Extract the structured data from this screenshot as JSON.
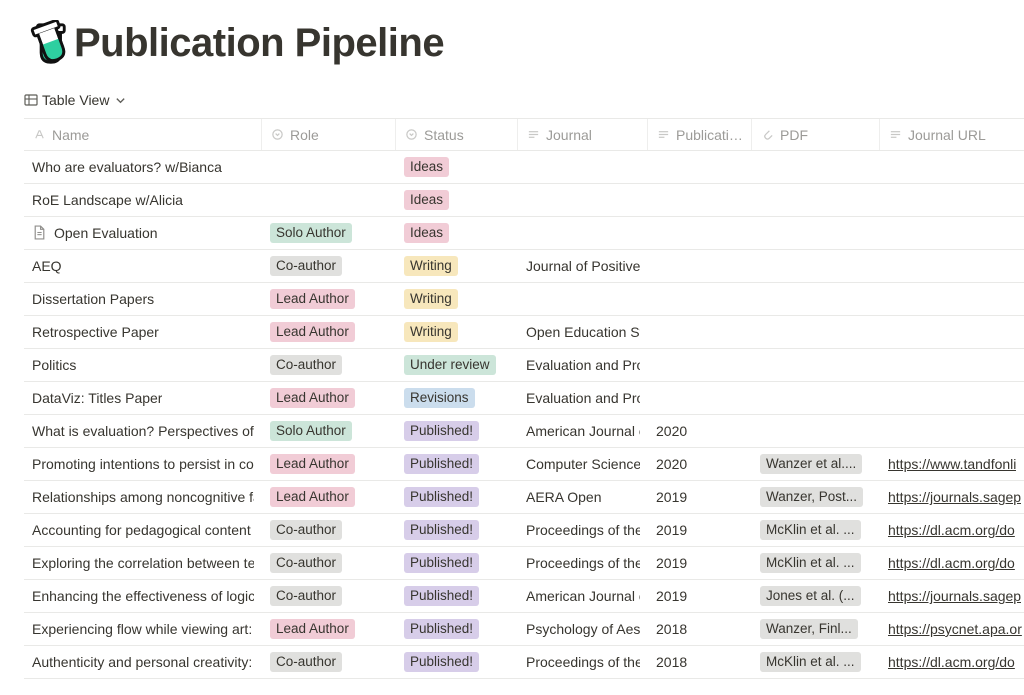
{
  "page": {
    "title": "Publication Pipeline"
  },
  "view": {
    "label": "Table View"
  },
  "columns": {
    "name": "Name",
    "role": "Role",
    "status": "Status",
    "journal": "Journal",
    "publication": "Publicati…",
    "pdf": "PDF",
    "journal_url": "Journal URL"
  },
  "tagColors": {
    "Solo Author": "green",
    "Co-author": "gray",
    "Lead Author": "pink",
    "Ideas": "pink",
    "Writing": "yellow",
    "Under review": "green",
    "Revisions": "blue",
    "Published!": "purple"
  },
  "rows": [
    {
      "name": "Who are evaluators? w/Bianca",
      "role": "",
      "status": "Ideas",
      "journal": "",
      "year": "",
      "pdf": "",
      "url": "",
      "hasIcon": false
    },
    {
      "name": "RoE Landscape w/Alicia",
      "role": "",
      "status": "Ideas",
      "journal": "",
      "year": "",
      "pdf": "",
      "url": "",
      "hasIcon": false
    },
    {
      "name": "Open Evaluation",
      "role": "Solo Author",
      "status": "Ideas",
      "journal": "",
      "year": "",
      "pdf": "",
      "url": "",
      "hasIcon": true
    },
    {
      "name": "AEQ",
      "role": "Co-author",
      "status": "Writing",
      "journal": "Journal of Positive ",
      "year": "",
      "pdf": "",
      "url": "",
      "hasIcon": false
    },
    {
      "name": "Dissertation Papers",
      "role": "Lead Author",
      "status": "Writing",
      "journal": "",
      "year": "",
      "pdf": "",
      "url": "",
      "hasIcon": false
    },
    {
      "name": "Retrospective Paper",
      "role": "Lead Author",
      "status": "Writing",
      "journal": "Open Education Stu",
      "year": "",
      "pdf": "",
      "url": "",
      "hasIcon": false
    },
    {
      "name": "Politics",
      "role": "Co-author",
      "status": "Under review",
      "journal": "Evaluation and Pro",
      "year": "",
      "pdf": "",
      "url": "",
      "hasIcon": false
    },
    {
      "name": "DataViz: Titles Paper",
      "role": "Lead Author",
      "status": "Revisions",
      "journal": "Evaluation and Pro",
      "year": "",
      "pdf": "",
      "url": "",
      "hasIcon": false
    },
    {
      "name": "What is evaluation? Perspectives of h",
      "role": "Solo Author",
      "status": "Published!",
      "journal": "American Journal o",
      "year": "2020",
      "pdf": "",
      "url": "",
      "hasIcon": false
    },
    {
      "name": "Promoting intentions to persist in co",
      "role": "Lead Author",
      "status": "Published!",
      "journal": "Computer Science",
      "year": "2020",
      "pdf": "Wanzer et al....",
      "url": "https://www.tandfonli",
      "hasIcon": false
    },
    {
      "name": "Relationships among noncognitive fa",
      "role": "Lead Author",
      "status": "Published!",
      "journal": "AERA Open",
      "year": "2019",
      "pdf": "Wanzer, Post...",
      "url": "https://journals.sagep",
      "hasIcon": false
    },
    {
      "name": "Accounting for pedagogical content",
      "role": "Co-author",
      "status": "Published!",
      "journal": "Proceedings of the",
      "year": "2019",
      "pdf": "McKlin et al. ...",
      "url": "https://dl.acm.org/do",
      "hasIcon": false
    },
    {
      "name": "Exploring the correlation between te",
      "role": "Co-author",
      "status": "Published!",
      "journal": "Proceedings of the",
      "year": "2019",
      "pdf": "McKlin et al. ...",
      "url": "https://dl.acm.org/do",
      "hasIcon": false
    },
    {
      "name": "Enhancing the effectiveness of logic ",
      "role": "Co-author",
      "status": "Published!",
      "journal": "American Journal o",
      "year": "2019",
      "pdf": "Jones et al. (...",
      "url": "https://journals.sagep",
      "hasIcon": false
    },
    {
      "name": "Experiencing flow while viewing art:",
      "role": "Lead Author",
      "status": "Published!",
      "journal": "Psychology of Aest",
      "year": "2018",
      "pdf": "Wanzer, Finl...",
      "url": "https://psycnet.apa.or",
      "hasIcon": false
    },
    {
      "name": "Authenticity and personal creativity:",
      "role": "Co-author",
      "status": "Published!",
      "journal": "Proceedings of the",
      "year": "2018",
      "pdf": "McKlin et al. ...",
      "url": "https://dl.acm.org/do",
      "hasIcon": false
    }
  ]
}
